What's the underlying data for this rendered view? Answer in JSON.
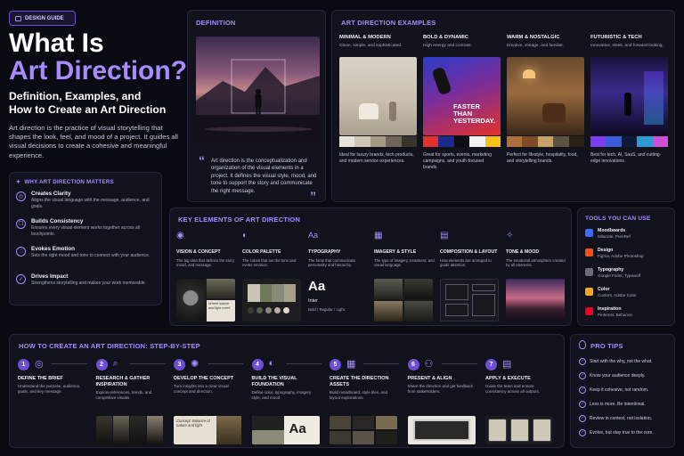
{
  "badge": "DESIGN GUIDE",
  "title": {
    "line1": "What Is",
    "line2": "Art Direction?"
  },
  "subtitle": {
    "line1": "Definition, Examples, and",
    "line2": "How to Create an Art Direction"
  },
  "intro": "Art direction is the practice of visual storytelling that shapes the look, feel, and mood of a project. It guides all visual decisions to create a cohesive and meaningful experience.",
  "why": {
    "heading": "WHY ART DIRECTION MATTERS",
    "items": [
      {
        "title": "Creates Clarity",
        "desc": "Aligns the visual language with the message, audience, and goals.",
        "icon": "target-icon"
      },
      {
        "title": "Builds Consistency",
        "desc": "Ensures every visual element works together across all touchpoints.",
        "icon": "layers-icon"
      },
      {
        "title": "Evokes Emotion",
        "desc": "Sets the right mood and tone to connect with your audience.",
        "icon": "heart-icon"
      },
      {
        "title": "Drives Impact",
        "desc": "Strengthens storytelling and makes your work memorable.",
        "icon": "check-circle-icon"
      }
    ]
  },
  "definition": {
    "heading": "DEFINITION",
    "quote": "Art direction is the conceptualization and organization of the visual elements in a project. It defines the visual style, mood, and tone to support the story and communicate the right message."
  },
  "examples": {
    "heading": "ART DIRECTION EXAMPLES",
    "items": [
      {
        "title": "MINIMAL & MODERN",
        "sub": "Clean, simple, and sophisticated.",
        "desc": "Ideal for luxury brands, tech products, and modern service experiences.",
        "swatches": [
          "#e9e4da",
          "#cfc6b8",
          "#a59884",
          "#6e655a",
          "#3a342e"
        ]
      },
      {
        "title": "BOLD & DYNAMIC",
        "sub": "High energy and contrast.",
        "desc": "Great for sports, events, marketing campaigns, and youth-focused brands.",
        "poster": [
          "FASTER",
          "THAN",
          "YESTERDAY."
        ],
        "swatches": [
          "#e3322c",
          "#1b2a8c",
          "#0e0e14",
          "#f2f2f2",
          "#f5c11b"
        ]
      },
      {
        "title": "WARM & NOSTALGIC",
        "sub": "Emotive, vintage, and familiar.",
        "desc": "Perfect for lifestyle, hospitality, food, and storytelling brands.",
        "swatches": [
          "#b0703a",
          "#7f4a25",
          "#c9a06a",
          "#5b5440",
          "#2b2016"
        ]
      },
      {
        "title": "FUTURISTIC & TECH",
        "sub": "Innovative, sleek, and forward-looking.",
        "desc": "Best for tech, AI, SaaS, and cutting-edge innovations.",
        "swatches": [
          "#7d3cf0",
          "#3b5bdb",
          "#0e1a3a",
          "#2e9bd6",
          "#d04fd6"
        ]
      }
    ]
  },
  "elements": {
    "heading": "KEY ELEMENTS OF ART DIRECTION",
    "items": [
      {
        "title": "VISION & CONCEPT",
        "desc": "The big idea that defines the story, mood, and message.",
        "icon": "eye-icon",
        "note": "Where nature and light meet."
      },
      {
        "title": "COLOR PALETTE",
        "desc": "The colors that set the tone and evoke emotion.",
        "icon": "palette-icon"
      },
      {
        "title": "TYPOGRAPHY",
        "desc": "The fonts that communicate personality and hierarchy.",
        "icon": "type-icon",
        "glyph": "Aa",
        "sample": "Aa",
        "font_name": "Inter",
        "weights": "Bold / Regular / Light"
      },
      {
        "title": "IMAGERY & STYLE",
        "desc": "The type of imagery, treatment, and visual language.",
        "icon": "grid-icon"
      },
      {
        "title": "COMPOSITION & LAYOUT",
        "desc": "How elements are arranged to guide attention.",
        "icon": "layout-icon"
      },
      {
        "title": "TONE & MOOD",
        "desc": "The emotional atmosphere created by all elements.",
        "icon": "sparkle-icon"
      }
    ]
  },
  "tools": {
    "heading": "TOOLS YOU CAN USE",
    "items": [
      {
        "title": "Moodboards",
        "desc": "Milanote, PureRef",
        "color": "#3d6bff"
      },
      {
        "title": "Design",
        "desc": "Figma, Adobe Photoshop",
        "color": "#f24e1e"
      },
      {
        "title": "Typography",
        "desc": "Google Fonts, Typewolf",
        "color": "#6b6b7a"
      },
      {
        "title": "Color",
        "desc": "Coolors, Adobe Color",
        "color": "#f5a623"
      },
      {
        "title": "Inspiration",
        "desc": "Pinterest, Behance",
        "color": "#e60023"
      }
    ]
  },
  "steps": {
    "heading": "HOW TO CREATE AN ART DIRECTION: STEP-BY-STEP",
    "items": [
      {
        "num": "1",
        "title": [
          "DEFINE THE BRIEF"
        ],
        "desc": "Understand the purpose, audience, goals, and key message.",
        "icon": "target-icon"
      },
      {
        "num": "2",
        "title": [
          "RESEARCH & GATHER",
          "INSPIRATION"
        ],
        "desc": "Explore references, trends, and competitive visuals.",
        "icon": "search-icon"
      },
      {
        "num": "3",
        "title": [
          "DEVELOP THE CONCEPT"
        ],
        "desc": "Turn insights into a clear visual concept and direction.",
        "icon": "lightbulb-icon",
        "note": "Concept: Balance of nature and light"
      },
      {
        "num": "4",
        "title": [
          "BUILD THE VISUAL",
          "FOUNDATION"
        ],
        "desc": "Define color, typography, imagery style, and mood.",
        "icon": "palette-icon",
        "glyph": "Aa"
      },
      {
        "num": "5",
        "title": [
          "CREATE THE DIRECTION",
          "ASSETS"
        ],
        "desc": "Build moodboard, style tiles, and layout explorations.",
        "icon": "grid-icon"
      },
      {
        "num": "6",
        "title": [
          "PRESENT & ALIGN"
        ],
        "desc": "Share the direction and get feedback from stakeholders.",
        "icon": "users-icon"
      },
      {
        "num": "7",
        "title": [
          "APPLY & EXECUTE"
        ],
        "desc": "Guide the team and ensure consistency across all outputs.",
        "icon": "layout-icon"
      }
    ]
  },
  "tips": {
    "heading": "PRO TIPS",
    "items": [
      "Start with the why, not the what.",
      "Know your audience deeply.",
      "Keep it cohesive, not random.",
      "Less is more. Be intentional.",
      "Review in context, not isolation.",
      "Evolve, but stay true to the core."
    ]
  }
}
